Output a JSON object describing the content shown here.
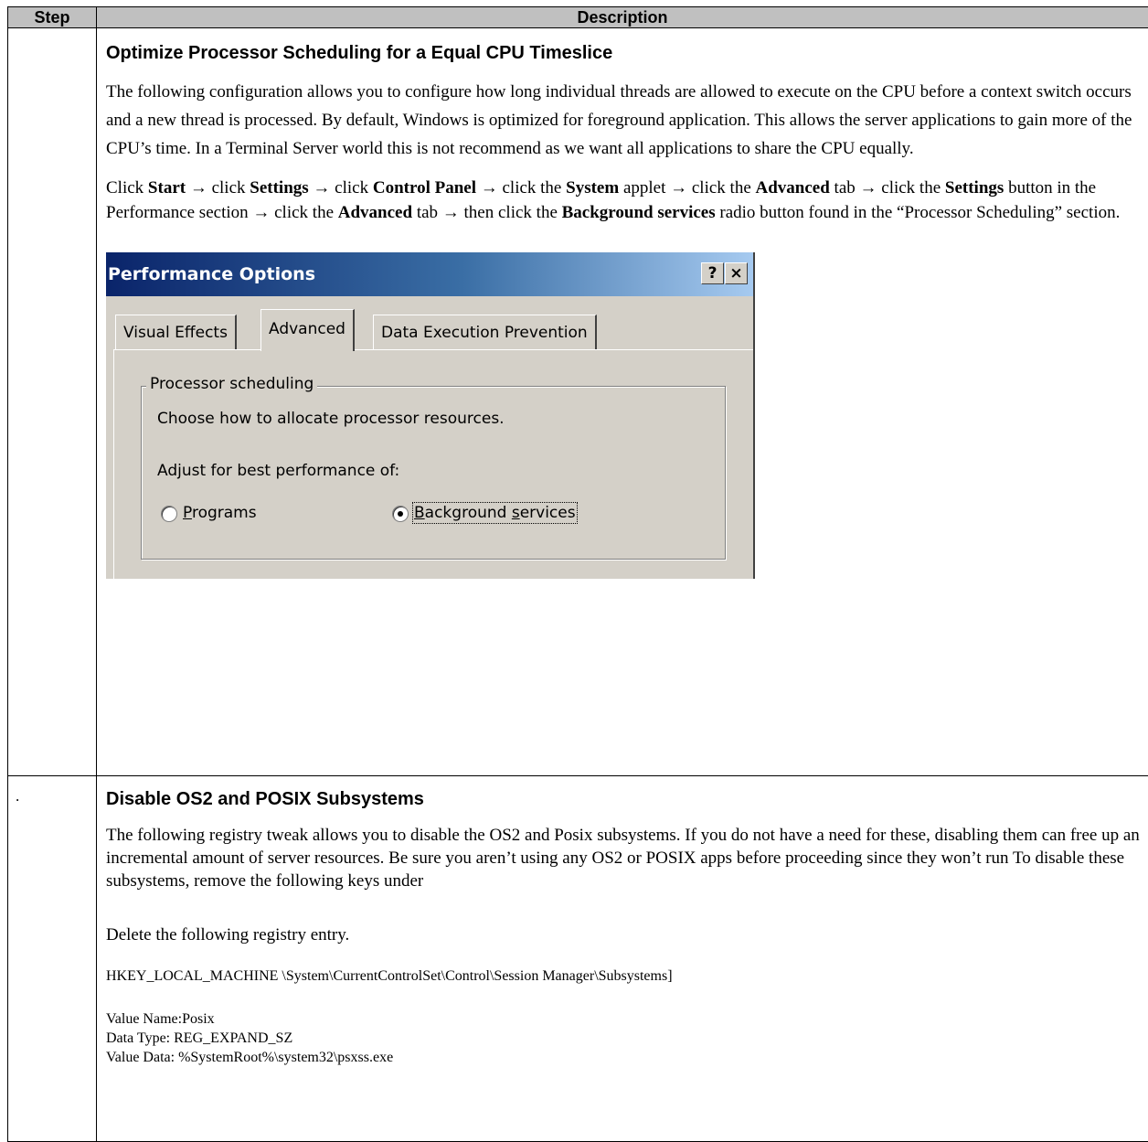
{
  "table": {
    "header_step": "Step",
    "header_description": "Description"
  },
  "section1": {
    "step": "",
    "title": "Optimize Processor Scheduling for a Equal CPU Timeslice",
    "para1": "The following configuration allows you to configure how long individual threads are allowed to execute on the CPU before a context switch occurs and a new thread is processed.  By default, Windows is optimized for foreground application.  This allows the server applications to gain more of the CPU’s time.  In a Terminal Server world this is not recommend as we want all applications to share the CPU equally.",
    "instr": {
      "t1": "Click ",
      "start": "Start",
      "t2": " → click ",
      "settings": "Settings",
      "t3": " → click ",
      "control_panel": "Control Panel",
      "t4": " → click the ",
      "system": "System",
      "t5": " applet → click the ",
      "advanced": "Advanced",
      "t6": " tab →  click the ",
      "settings2": "Settings",
      "t7": " button in the Performance section → click the ",
      "advanced2": "Advanced",
      "t8": " tab → then click the ",
      "background_services": "Background services",
      "t9": " radio button found in the “Processor Scheduling” section."
    },
    "dialog": {
      "title": "Performance Options",
      "help_btn": "?",
      "close_btn": "×",
      "tabs": [
        "Visual Effects",
        "Advanced",
        "Data Execution Prevention"
      ],
      "group_title": "Processor scheduling",
      "group_desc": "Choose how to allocate processor resources.",
      "adjust_label": "Adjust for best performance of:",
      "radio_programs_first": "P",
      "radio_programs_rest": "rograms",
      "radio_background_first": "B",
      "radio_background_mid": "ackground ",
      "radio_background_s": "s",
      "radio_background_rest": "ervices"
    }
  },
  "section2": {
    "step": ".",
    "title": "Disable OS2 and POSIX Subsystems",
    "para1": "The following registry tweak allows you to disable the OS2 and Posix subsystems.  If you do not have a need for these, disabling them can free up an incremental amount of server resources. Be sure you aren’t using any OS2 or POSIX apps before proceeding since they won’t run To disable these subsystems, remove the following keys under",
    "para2": "Delete the following registry entry.",
    "registry_key": "HKEY_LOCAL_MACHINE \\System\\CurrentControlSet\\Control\\Session Manager\\Subsystems]",
    "value_name": "Value Name:Posix",
    "data_type": "Data Type: REG_EXPAND_SZ",
    "value_data": "Value Data: %SystemRoot%\\system32\\psxss.exe"
  }
}
